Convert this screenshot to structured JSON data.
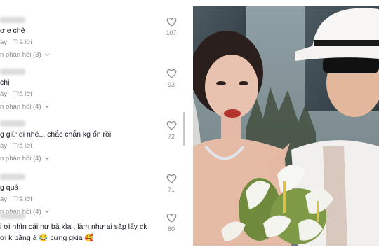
{
  "comments": [
    {
      "text": "ơ e chê",
      "time": "ày",
      "reply_label": "Trả lời",
      "likes": "107",
      "view_replies": "n phản hồi (3)"
    },
    {
      "text": "chị",
      "time": "ày",
      "reply_label": "Trả lời",
      "likes": "93",
      "view_replies": "n phản hồi (4)"
    },
    {
      "text": "g giữ đi nhé... chắc chắn kg ổn rồi",
      "time": "ày",
      "reply_label": "Trả lời",
      "likes": "72",
      "view_replies": "n phản hồi (4)"
    },
    {
      "text": "g quá",
      "time": "ày",
      "reply_label": "Trả lời",
      "likes": "71",
      "view_replies": "n phản hồi (4)"
    },
    {
      "text": "i ơi nhìn cái nư bả kìa , làm như ai sắp lấy ck",
      "text2": "ơi k bằng á 😂 cưng gkia 🥰",
      "likes": "60"
    }
  ],
  "colors": {
    "text": "#161823",
    "meta": "#8a8b91",
    "like_icon": "#8a8b91"
  },
  "icons": [
    "heart-outline-icon",
    "chevron-down-icon"
  ]
}
